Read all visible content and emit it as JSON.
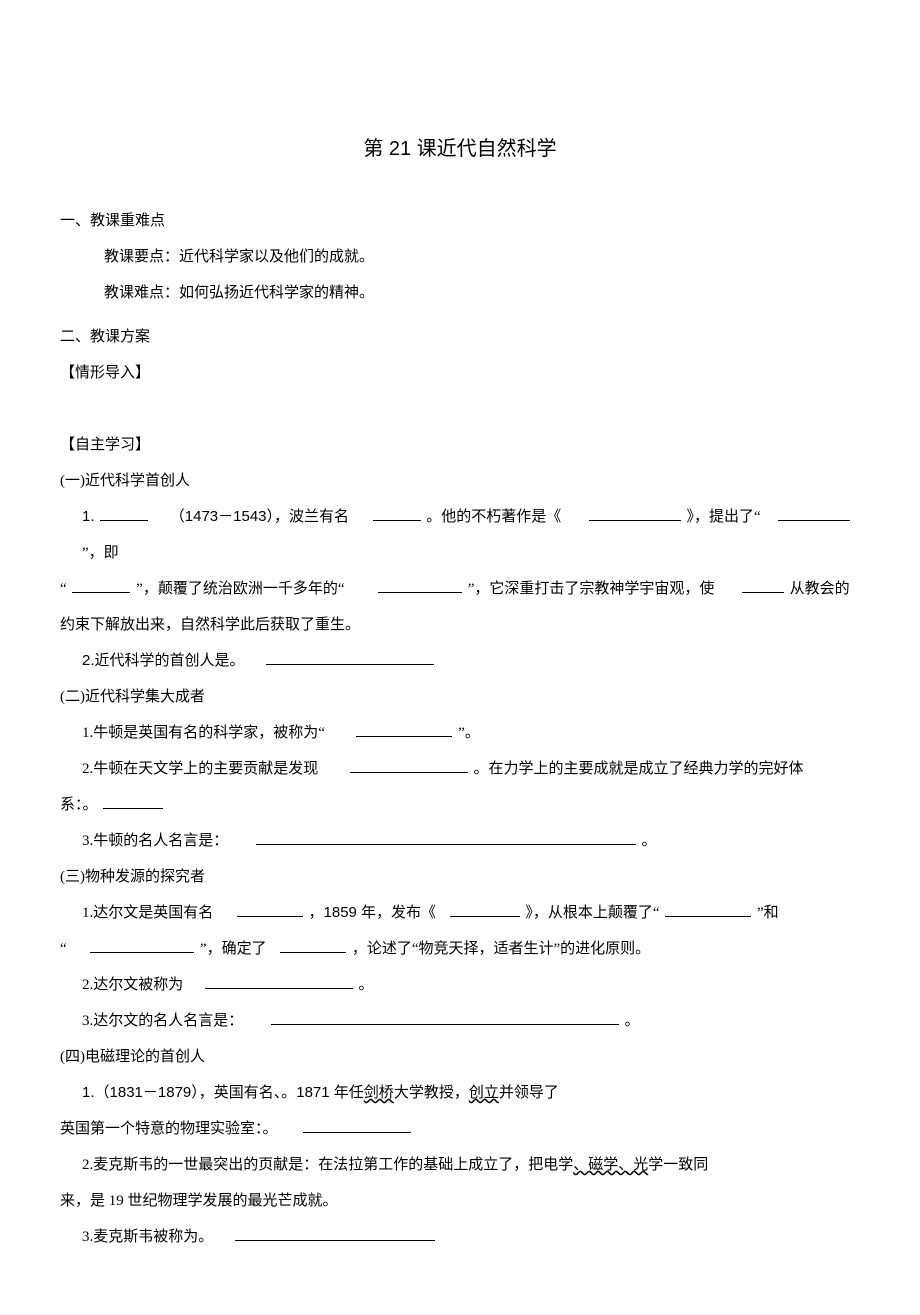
{
  "title": "第 21 课近代自然科学",
  "sec1": {
    "heading": "一、教课重难点",
    "l1": "教课要点：近代科学家以及他们的成就。",
    "l2": "教课难点：如何弘扬近代科学家的精神。"
  },
  "sec2": {
    "heading": "二、教课方案",
    "intro": "【情形导入】",
    "self": "【自主学习】"
  },
  "a": {
    "h": "(一)近代科学首创人",
    "p1a": "1.",
    "p1b": "（1473－1543），波兰有名",
    "p1c": "。他的不朽著作是《",
    "p1d": "》，提出了“",
    "p1e": "”，即",
    "p1f": "“",
    "p1g": "”，颠覆了统治欧洲一千多年的“",
    "p1h": "”，它深重打击了宗教神学宇宙观，使",
    "p1i": "从教会的",
    "p1j": "约束下解放出来，自然科学此后获取了重生。",
    "p2a": "2.近代科学的首创人是。"
  },
  "b": {
    "h": "(二)近代科学集大成者",
    "p1a": "1.牛顿是英国有名的科学家，被称为“",
    "p1b": "”。",
    "p2a": "2.牛顿在天文学上的主要贡献是发现",
    "p2b": "。在力学上的主要成就是成立了经典力学的完好体",
    "p2c": "系：。",
    "p3a": "3.牛顿的名人名言是：",
    "p3b": "。"
  },
  "c": {
    "h": "(三)物种发源的探究者",
    "p1a": "1.达尔文是英国有名",
    "p1b": "，1859 年，发布《",
    "p1c": "》，从根本上颠覆了“",
    "p1d": "”和",
    "p1e": "“",
    "p1f": "”，确定了",
    "p1g": "，论述了“物竞天择，适者生计”的进化原则。",
    "p2a": "2.达尔文被称为",
    "p2b": "。",
    "p3a": "3.达尔文的名人名言是：",
    "p3b": "。"
  },
  "d": {
    "h": "(四)电磁理论的首创人",
    "p1a": "1.（1831－1879），英国有名、。1871 年任",
    "p1a_wavy1": "剑桥",
    "p1a_mid": "大学教授，",
    "p1a_wavy2": "创立",
    "p1a_end": "并领导了",
    "p1b": "英国第一个特意的物理实验室：。",
    "p2a": "2.麦克斯韦的一世最突出的页献是：在法拉第工作的基础上成立了，把电学",
    "p2a_wavy": "、磁学、光",
    "p2a_end": "学一致同",
    "p2b": "来，是 19 世纪物理学发展的最光芒成就。",
    "p3a": "3.麦克斯韦被称为。"
  }
}
